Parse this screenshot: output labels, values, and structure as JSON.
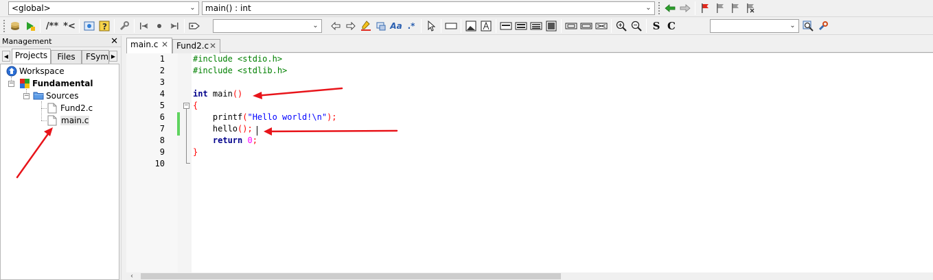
{
  "toolbar_top": {
    "scope_combo": "<global>",
    "function_combo": "main() : int"
  },
  "toolbar_second": {
    "search_combo": "",
    "second_search_combo": "",
    "comment_label": "/**",
    "uncomment_label": "*<",
    "bold_s": "S",
    "bold_c": "C"
  },
  "management": {
    "title": "Management",
    "close": "✕",
    "tabs": [
      "Projects",
      "Files",
      "FSymb"
    ],
    "tree": {
      "workspace": "Workspace",
      "project": "Fundamental",
      "folder": "Sources",
      "files": [
        "Fund2.c",
        "main.c"
      ]
    }
  },
  "editor": {
    "tabs": [
      {
        "label": "main.c",
        "close": "✕"
      },
      {
        "label": "Fund2.c",
        "close": "✕"
      }
    ],
    "line_numbers": [
      "1",
      "2",
      "3",
      "4",
      "5",
      "6",
      "7",
      "8",
      "9",
      "10"
    ],
    "lines": [
      [
        {
          "t": "#include <stdio.h>",
          "c": "pp"
        }
      ],
      [
        {
          "t": "#include <stdlib.h>",
          "c": "pp"
        }
      ],
      [],
      [
        {
          "t": "int",
          "c": "kw"
        },
        {
          "t": " main",
          "c": "plain"
        },
        {
          "t": "()",
          "c": "op"
        }
      ],
      [
        {
          "t": "{",
          "c": "op"
        }
      ],
      [
        {
          "t": "    printf",
          "c": "plain"
        },
        {
          "t": "(",
          "c": "op"
        },
        {
          "t": "\"Hello world!\\n\"",
          "c": "str"
        },
        {
          "t": ");",
          "c": "op"
        }
      ],
      [
        {
          "t": "    hello",
          "c": "plain"
        },
        {
          "t": "();",
          "c": "op"
        }
      ],
      [
        {
          "t": "    ",
          "c": "plain"
        },
        {
          "t": "return",
          "c": "kw"
        },
        {
          "t": " ",
          "c": "plain"
        },
        {
          "t": "0",
          "c": "num"
        },
        {
          "t": ";",
          "c": "op"
        }
      ],
      [
        {
          "t": "}",
          "c": "op"
        }
      ],
      []
    ]
  },
  "colors": {
    "annotation_arrow": "#e8141a",
    "change_bar": "#5fd35f"
  }
}
